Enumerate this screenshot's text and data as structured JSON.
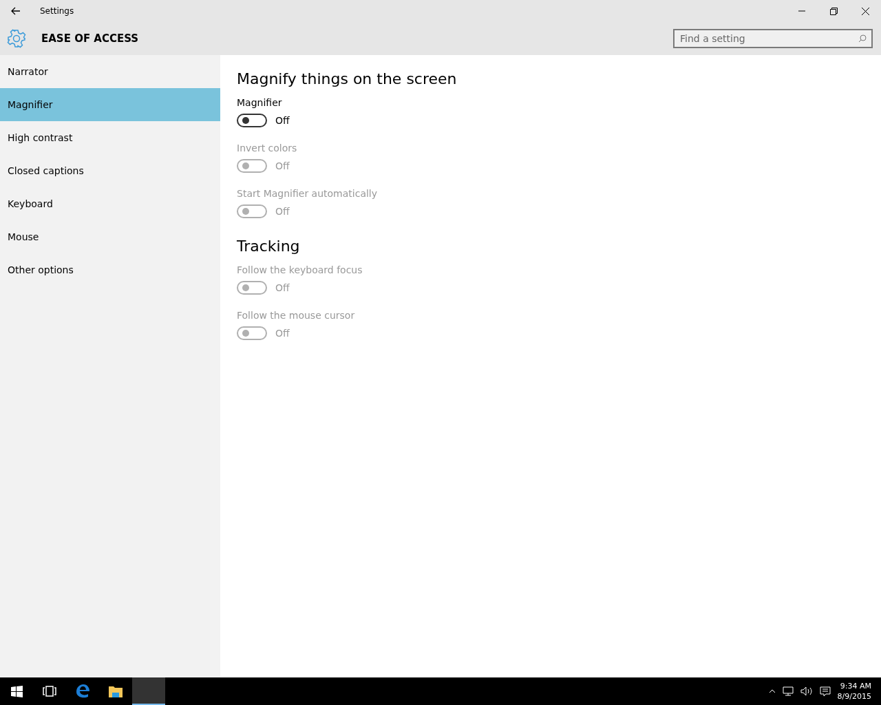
{
  "window": {
    "title": "Settings"
  },
  "header": {
    "title": "EASE OF ACCESS",
    "search": {
      "placeholder": "Find a setting"
    }
  },
  "sidebar": {
    "items": [
      {
        "label": "Narrator",
        "selected": false
      },
      {
        "label": "Magnifier",
        "selected": true
      },
      {
        "label": "High contrast",
        "selected": false
      },
      {
        "label": "Closed captions",
        "selected": false
      },
      {
        "label": "Keyboard",
        "selected": false
      },
      {
        "label": "Mouse",
        "selected": false
      },
      {
        "label": "Other options",
        "selected": false
      }
    ]
  },
  "sections": [
    {
      "heading": "Magnify things on the screen",
      "toggles": [
        {
          "label": "Magnifier",
          "state": "Off",
          "on": false,
          "disabled": false
        },
        {
          "label": "Invert colors",
          "state": "Off",
          "on": false,
          "disabled": true
        },
        {
          "label": "Start Magnifier automatically",
          "state": "Off",
          "on": false,
          "disabled": true
        }
      ]
    },
    {
      "heading": "Tracking",
      "toggles": [
        {
          "label": "Follow the keyboard focus",
          "state": "Off",
          "on": false,
          "disabled": true
        },
        {
          "label": "Follow the mouse cursor",
          "state": "Off",
          "on": false,
          "disabled": true
        }
      ]
    }
  ],
  "taskbar": {
    "apps": [
      {
        "kind": "taskview",
        "selected": false
      },
      {
        "kind": "edge",
        "selected": false
      },
      {
        "kind": "explorer",
        "selected": false
      },
      {
        "kind": "settings",
        "selected": true
      }
    ],
    "time": "9:34 AM",
    "date": "8/9/2015"
  }
}
